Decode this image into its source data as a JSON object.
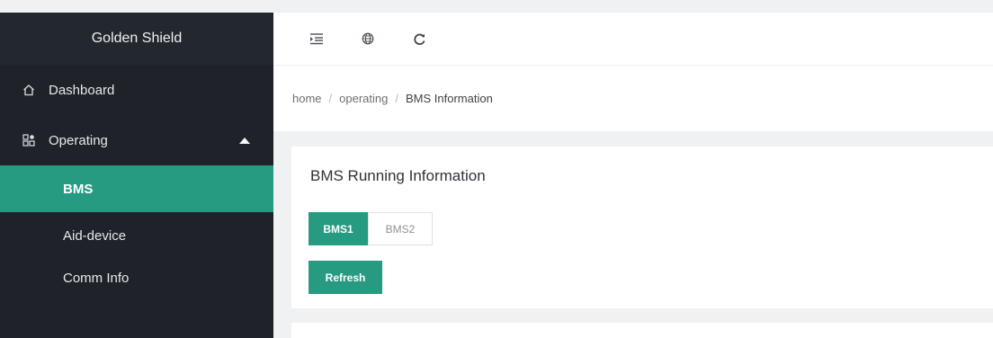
{
  "app": {
    "brand": "Golden Shield"
  },
  "toolbar": {
    "icons": [
      "menu-fold-icon",
      "globe-icon",
      "reload-icon"
    ]
  },
  "sidebar": {
    "items": [
      {
        "label": "Dashboard",
        "icon": "home-icon"
      },
      {
        "label": "Operating",
        "icon": "grid-icon",
        "expanded": true,
        "children": [
          {
            "label": "BMS",
            "active": true
          },
          {
            "label": "Aid-device"
          },
          {
            "label": "Comm Info"
          }
        ]
      }
    ]
  },
  "breadcrumb": {
    "home": "home",
    "sep": "/",
    "section": "operating",
    "current": "BMS Information"
  },
  "card": {
    "title": "BMS Running Information",
    "tabs": [
      {
        "label": "BMS1",
        "active": true
      },
      {
        "label": "BMS2",
        "active": false
      }
    ],
    "refresh_label": "Refresh"
  },
  "colors": {
    "accent": "#279a82",
    "sidebar_bg": "#1f2329",
    "page_bg": "#f0f1f3"
  }
}
